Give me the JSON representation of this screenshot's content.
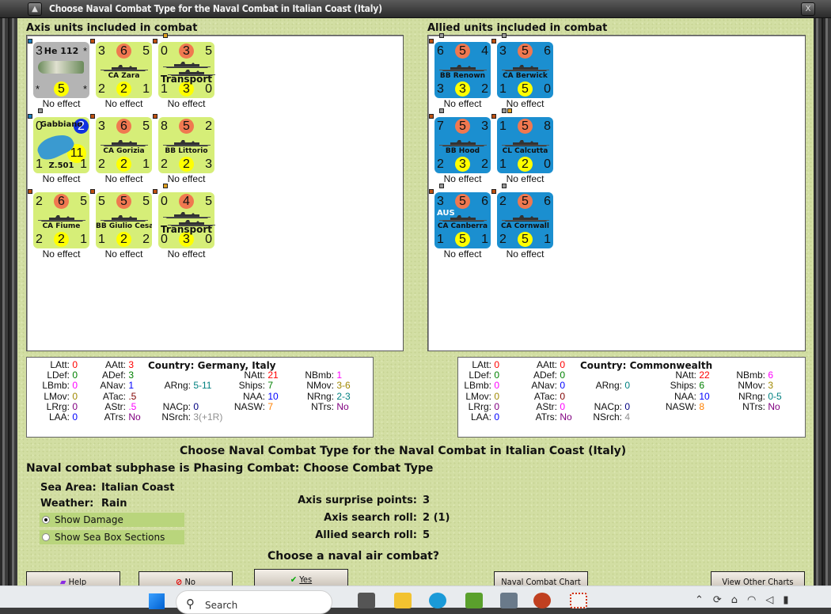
{
  "window": {
    "title": "Choose Naval Combat Type for the Naval Combat in Italian Coast (Italy)"
  },
  "axis": {
    "header": "Axis units included in combat",
    "units": [
      {
        "kind": "air",
        "name": "He 112",
        "top": [
          "3",
          "",
          "*"
        ],
        "bottom": [
          "*",
          "5",
          "*"
        ],
        "effect": "No effect",
        "markers": [
          "#1a7fc0"
        ]
      },
      {
        "kind": "axis",
        "name": "CA Zara",
        "top": [
          "3",
          "6",
          "5"
        ],
        "bottom": [
          "2",
          "2",
          "1"
        ],
        "effect": "No effect",
        "markers": [
          "#c05010"
        ]
      },
      {
        "kind": "axis",
        "name": "Transport",
        "big": true,
        "top": [
          "0",
          "3",
          "5"
        ],
        "bottom": [
          "1",
          "3",
          "0"
        ],
        "effect": "No effect",
        "markers": [
          "#c05010",
          "#e0a020"
        ]
      },
      {
        "kind": "flyboat",
        "name": "Gabbiano",
        "name2": "Z.501",
        "top": [
          "0",
          "2",
          ""
        ],
        "bottom": [
          "1",
          "11",
          "1"
        ],
        "effect": "No effect",
        "markers": [
          "#1a7fc0",
          "#999999"
        ]
      },
      {
        "kind": "axis",
        "name": "CA Gorizia",
        "top": [
          "3",
          "6",
          "5"
        ],
        "bottom": [
          "2",
          "2",
          "1"
        ],
        "effect": "No effect",
        "markers": [
          "#c05010"
        ]
      },
      {
        "kind": "axis",
        "name": "BB Littorio",
        "top": [
          "8",
          "5",
          "2"
        ],
        "bottom": [
          "2",
          "2",
          "3"
        ],
        "effect": "No effect",
        "markers": [
          "#c05010"
        ]
      },
      {
        "kind": "axis",
        "name": "CA Fiume",
        "top": [
          "2",
          "6",
          "5"
        ],
        "bottom": [
          "2",
          "2",
          "1"
        ],
        "effect": "No effect",
        "markers": [
          "#c05010"
        ]
      },
      {
        "kind": "axis",
        "name": "BB Giulio Cesar",
        "top": [
          "5",
          "5",
          "5"
        ],
        "bottom": [
          "1",
          "2",
          "2"
        ],
        "effect": "No effect",
        "markers": [
          "#c05010"
        ]
      },
      {
        "kind": "axis",
        "name": "Transport",
        "big": true,
        "top": [
          "0",
          "4",
          "5"
        ],
        "bottom": [
          "0",
          "3",
          "0"
        ],
        "effect": "No effect",
        "markers": [
          "#c05010",
          "#e0a020"
        ]
      }
    ],
    "stats": {
      "country": "Country: Germany, Italy",
      "rows": [
        [
          [
            "LAtt",
            "0"
          ],
          [
            "AAtt",
            "3"
          ],
          null,
          null,
          null
        ],
        [
          [
            "LDef",
            "0"
          ],
          [
            "ADef",
            "3"
          ],
          null,
          [
            "NAtt",
            "21"
          ],
          [
            "NBmb",
            "1"
          ]
        ],
        [
          [
            "LBmb",
            "0"
          ],
          [
            "ANav",
            "1"
          ],
          [
            "ARng",
            "5-11"
          ],
          [
            "Ships",
            "7"
          ],
          [
            "NMov",
            "3-6"
          ]
        ],
        [
          [
            "LMov",
            "0"
          ],
          [
            "ATac",
            ".5"
          ],
          null,
          [
            "NAA",
            "10"
          ],
          [
            "NRng",
            "2-3"
          ]
        ],
        [
          [
            "LRrg",
            "0"
          ],
          [
            "AStr",
            ".5"
          ],
          [
            "NACp",
            "0"
          ],
          [
            "NASW",
            "7"
          ],
          [
            "NTrs",
            "No"
          ]
        ],
        [
          [
            "LAA",
            "0"
          ],
          [
            "ATrs",
            "No"
          ],
          [
            "NSrch",
            "3(+1R)"
          ],
          null,
          null
        ]
      ]
    }
  },
  "allied": {
    "header": "Allied units included in combat",
    "units": [
      {
        "kind": "allied",
        "name": "BB Renown",
        "top": [
          "6",
          "5",
          "4"
        ],
        "bottom": [
          "3",
          "3",
          "2"
        ],
        "effect": "No effect",
        "markers": [
          "#c05010",
          "#999999"
        ]
      },
      {
        "kind": "allied",
        "name": "CA Berwick",
        "top": [
          "3",
          "5",
          "6"
        ],
        "bottom": [
          "1",
          "5",
          "0"
        ],
        "effect": "No effect",
        "markers": [
          "#c05010",
          "#999999"
        ]
      },
      {
        "kind": "allied",
        "name": "BB Hood",
        "top": [
          "7",
          "5",
          "3"
        ],
        "bottom": [
          "2",
          "3",
          "2"
        ],
        "effect": "No effect",
        "markers": [
          "#c05010",
          "#999999"
        ]
      },
      {
        "kind": "allied",
        "name": "CL Calcutta",
        "top": [
          "1",
          "5",
          "8"
        ],
        "bottom": [
          "1",
          "2",
          "0"
        ],
        "effect": "No effect",
        "markers": [
          "#c05010",
          "#999999",
          "#e0a020"
        ]
      },
      {
        "kind": "allied",
        "name": "CA Canberra",
        "flag": "AUS",
        "top": [
          "3",
          "5",
          "6"
        ],
        "bottom": [
          "1",
          "5",
          "1"
        ],
        "effect": "No effect",
        "markers": [
          "#c05010",
          "#999999"
        ]
      },
      {
        "kind": "allied",
        "name": "CA Cornwall",
        "top": [
          "2",
          "5",
          "6"
        ],
        "bottom": [
          "2",
          "5",
          "1"
        ],
        "effect": "No effect",
        "markers": [
          "#c05010",
          "#999999"
        ]
      }
    ],
    "stats": {
      "country": "Country: Commonwealth",
      "rows": [
        [
          [
            "LAtt",
            "0"
          ],
          [
            "AAtt",
            "0"
          ],
          null,
          null,
          null
        ],
        [
          [
            "LDef",
            "0"
          ],
          [
            "ADef",
            "0"
          ],
          null,
          [
            "NAtt",
            "22"
          ],
          [
            "NBmb",
            "6"
          ]
        ],
        [
          [
            "LBmb",
            "0"
          ],
          [
            "ANav",
            "0"
          ],
          [
            "ARng",
            "0"
          ],
          [
            "Ships",
            "6"
          ],
          [
            "NMov",
            "3"
          ]
        ],
        [
          [
            "LMov",
            "0"
          ],
          [
            "ATac",
            "0"
          ],
          null,
          [
            "NAA",
            "10"
          ],
          [
            "NRng",
            "0-5"
          ]
        ],
        [
          [
            "LRrg",
            "0"
          ],
          [
            "AStr",
            "0"
          ],
          [
            "NACp",
            "0"
          ],
          [
            "NASW",
            "8"
          ],
          [
            "NTrs",
            "No"
          ]
        ],
        [
          [
            "LAA",
            "0"
          ],
          [
            "ATrs",
            "No"
          ],
          [
            "NSrch",
            "4"
          ],
          null,
          null
        ]
      ]
    }
  },
  "stat_colors": {
    "LAtt": "#ff0000",
    "LDef": "#008000",
    "LBmb": "#ff00ff",
    "LMov": "#a08800",
    "LRrg": "#800080",
    "LAA": "#0000ff",
    "AAtt": "#ff0000",
    "ADef": "#008000",
    "ANav": "#0000ff",
    "ATac": "#800000",
    "AStr": "#ff00ff",
    "ATrs": "#800080",
    "ARng": "#008080",
    "NACp": "#000080",
    "NSrch": "#909090",
    "NAtt": "#ff0000",
    "Ships": "#008000",
    "NAA": "#0000ff",
    "NASW": "#ff8000",
    "NBmb": "#ff00ff",
    "NMov": "#a08800",
    "NRng": "#008080",
    "NTrs": "#800080"
  },
  "main": {
    "heading": "Choose Naval Combat Type for the Naval Combat in Italian Coast (Italy)",
    "subphase": "Naval combat subphase is Phasing Combat: Choose Combat Type",
    "sea_area_label": "Sea Area:",
    "sea_area": "Italian Coast",
    "weather_label": "Weather:",
    "weather": "Rain",
    "show_damage": "Show Damage",
    "show_sections": "Show Sea Box Sections",
    "surprise_label": "Axis surprise points:",
    "surprise": "3",
    "axis_search_label": "Axis search roll:",
    "axis_search": "2 (1)",
    "allied_search_label": "Allied search roll:",
    "allied_search": "5",
    "question": "Choose a naval air combat?"
  },
  "buttons": {
    "help": "Help",
    "no": "No",
    "yes": "Yes",
    "chart": "Naval Combat Chart",
    "other": "View Other Charts"
  },
  "taskbar": {
    "search_placeholder": "Search"
  }
}
